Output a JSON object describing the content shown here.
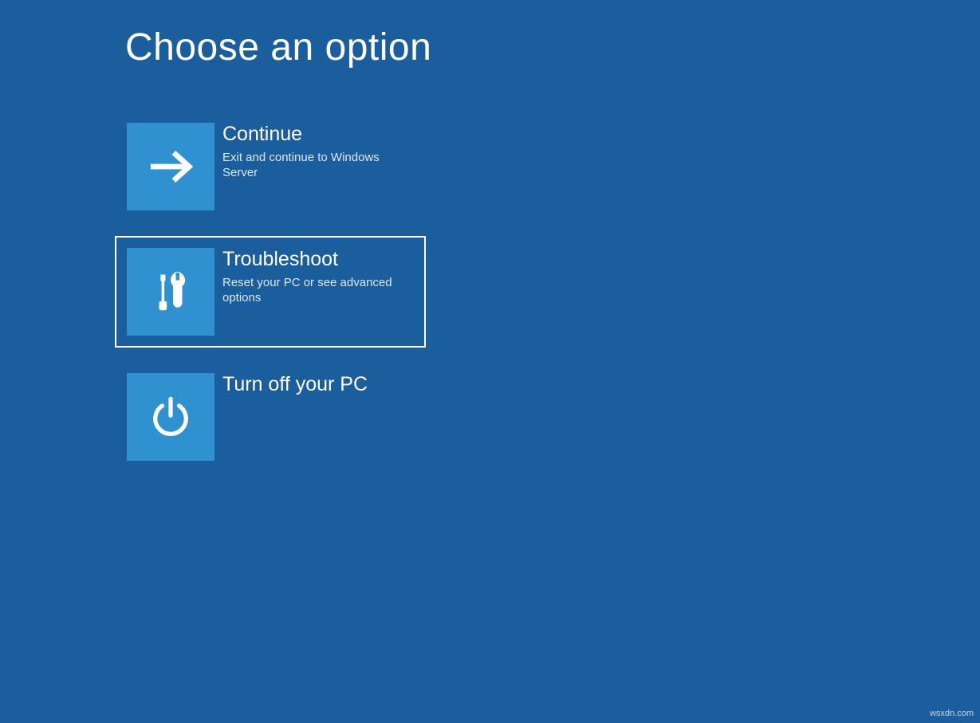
{
  "page_title": "Choose an option",
  "options": [
    {
      "id": "continue",
      "title": "Continue",
      "description": "Exit and continue to Windows Server",
      "selected": false
    },
    {
      "id": "troubleshoot",
      "title": "Troubleshoot",
      "description": "Reset your PC or see advanced options",
      "selected": true
    },
    {
      "id": "turnoff",
      "title": "Turn off your PC",
      "description": "",
      "selected": false
    }
  ],
  "watermark": "wsxdn.com",
  "colors": {
    "background": "#1b5e9e",
    "tile": "#2f91d0",
    "text": "#ffffff",
    "subtext": "#dce7f1"
  }
}
